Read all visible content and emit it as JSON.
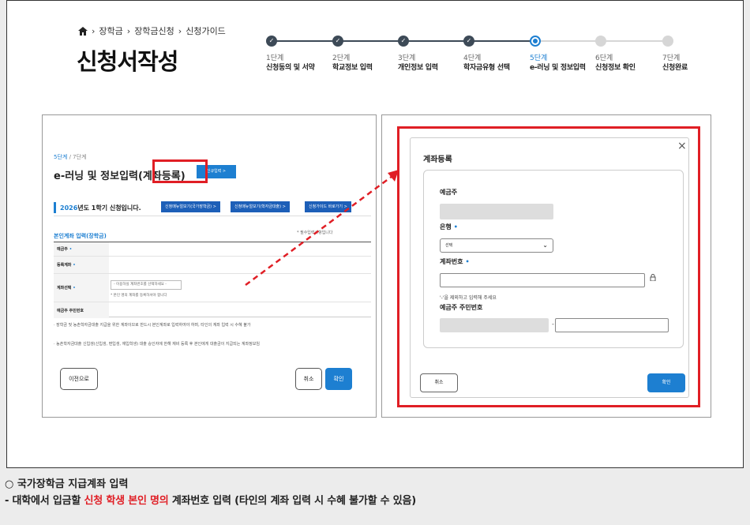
{
  "breadcrumb": [
    "장학금",
    "장학금신청",
    "신청가이드"
  ],
  "page_title": "신청서작성",
  "stepper": [
    {
      "num": "1단계",
      "label": "신청동의 및 서약",
      "state": "done"
    },
    {
      "num": "2단계",
      "label": "학교정보 입력",
      "state": "done"
    },
    {
      "num": "3단계",
      "label": "개인정보 입력",
      "state": "done"
    },
    {
      "num": "4단계",
      "label": "학자금유형 선택",
      "state": "done"
    },
    {
      "num": "5단계",
      "label": "e-러닝 및 정보입력",
      "state": "current"
    },
    {
      "num": "6단계",
      "label": "신청정보 확인",
      "state": "todo"
    },
    {
      "num": "7단계",
      "label": "신청완료",
      "state": "todo"
    }
  ],
  "left": {
    "step_cur": "5단계",
    "step_total": " / 7단계",
    "heading": "e-러닝 및 정보입력(계좌등록)",
    "year": "2026",
    "semester_text": "년도 1학기 신청입니다.",
    "link_buttons": [
      "신청매뉴얼보기(국가장학금) >",
      "신청매뉴얼보기(학자금대출) >",
      "신청가이드 바로가기 >"
    ],
    "section_title": "본인계좌 입력(장학금)",
    "required_note": "* 필수입력사항입니다",
    "rows": [
      "예금주",
      "등록계좌",
      "계좌선택",
      "예금주 주민번호"
    ],
    "select_placeholder": "- 이용하실 계좌번호를 선택하세요 -",
    "select_sub": "* 본인 명의 계좌를 등록하셔야 합니다",
    "new_input": "신규입력 >",
    "notes": [
      "· 장학금 및 농촌학자금대출 지급을 위한 계좌이므로 반드시 본인계좌로 입력하여야 하며, 타인의 계좌 입력 시 수혜 불가",
      "· 농촌학자금대출 신입생(신입생, 편입생, 재입학생) 대출 승인자에 한해 재비 등록 후 본인에게 대출금이 지급되는 계좌정보임"
    ],
    "prev_button": "이전으로",
    "cancel_button": "취소",
    "ok_button": "확인"
  },
  "modal": {
    "title": "계좌등록",
    "close": "×",
    "holder_label": "예금주",
    "bank_label": "은행",
    "bank_select": "선택",
    "account_label": "계좌번호",
    "account_hint": "'-'을 제외하고 입력해 주세요",
    "id_label": "예금주 주민번호",
    "cancel_button": "취소",
    "ok_button": "확인"
  },
  "caption": {
    "line1": "○ 국가장학금 지급계좌 입력",
    "line2_a": "- 대학에서 입금할 ",
    "line2_red": "신청 학생 본인 명의",
    "line2_b": " 계좌번호 입력 (타인의 계좌 입력 시 수혜 불가할 수 있음)"
  },
  "colors": {
    "accent": "#1d7fd1",
    "highlight": "#e01e25",
    "step_done": "#3d4a57"
  }
}
